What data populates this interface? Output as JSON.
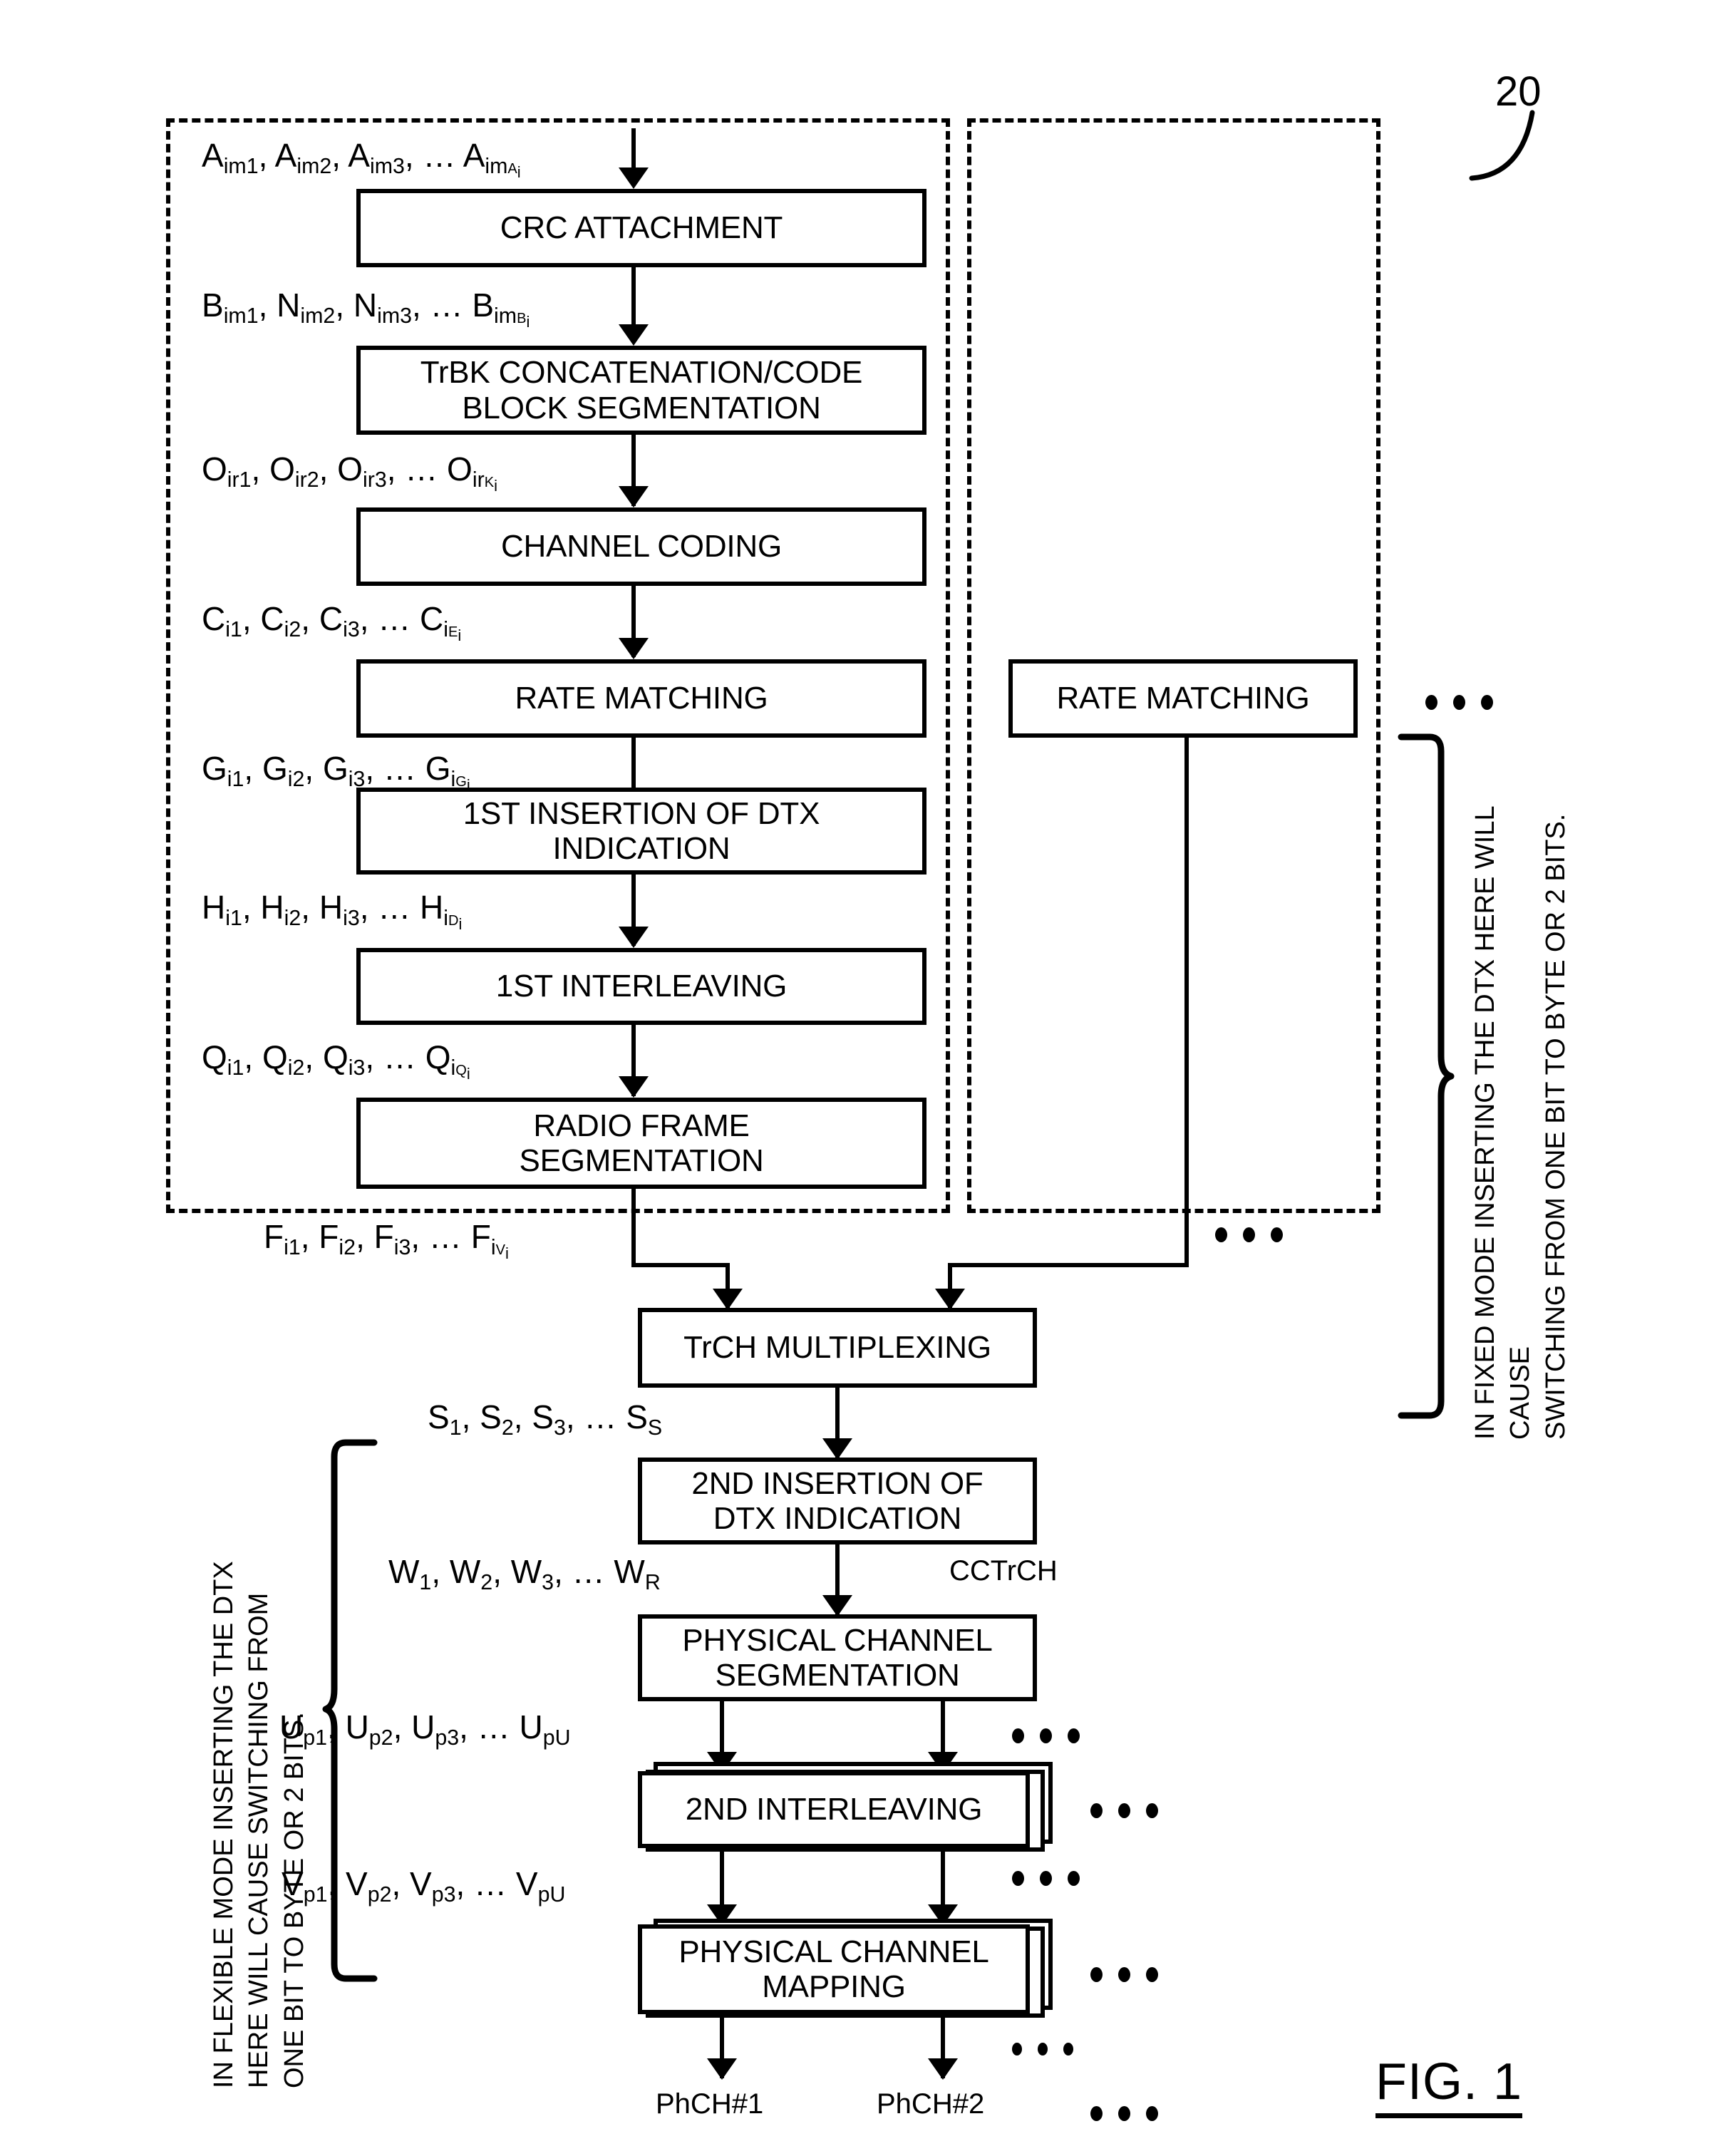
{
  "figure": {
    "reference_numeral": "20",
    "caption": "FIG. 1"
  },
  "blocks": {
    "crc_attachment": "CRC ATTACHMENT",
    "trbk_concat_line1": "TrBK CONCATENATION/CODE",
    "trbk_concat_line2": "BLOCK SEGMENTATION",
    "channel_coding": "CHANNEL CODING",
    "rate_matching": "RATE MATCHING",
    "rate_matching_2": "RATE MATCHING",
    "dtx1_line1": "1ST INSERTION OF DTX",
    "dtx1_line2": "INDICATION",
    "interleaving1": "1ST INTERLEAVING",
    "radio_frame_line1": "RADIO FRAME",
    "radio_frame_line2": "SEGMENTATION",
    "trch_mux": "TrCH MULTIPLEXING",
    "dtx2_line1": "2ND INSERTION OF",
    "dtx2_line2": "DTX INDICATION",
    "phch_seg_line1": "PHYSICAL CHANNEL",
    "phch_seg_line2": "SEGMENTATION",
    "interleaving2": "2ND INTERLEAVING",
    "phch_map_line1": "PHYSICAL CHANNEL",
    "phch_map_line2": "MAPPING"
  },
  "signals": {
    "a": {
      "base": "A",
      "items": [
        "im1",
        "im2",
        "im3"
      ],
      "last_sub": "im",
      "last_sup": "A",
      "last_sup_sub": "i"
    },
    "b": {
      "parts": [
        "B|im1",
        "N|im2",
        "N|im3"
      ],
      "last_base": "B",
      "last_sub": "im",
      "last_sup": "B",
      "last_sup_sub": "i"
    },
    "o": {
      "base": "O",
      "items": [
        "ir1",
        "ir2",
        "ir3"
      ],
      "last_sub": "ir",
      "last_sup": "K",
      "last_sup_sub": "i"
    },
    "c": {
      "base": "C",
      "items": [
        "i1",
        "i2",
        "i3"
      ],
      "last_sub": "i",
      "last_sup": "E",
      "last_sup_sub": "i"
    },
    "g": {
      "base": "G",
      "items": [
        "i1",
        "i2",
        "i3"
      ],
      "last_sub": "i",
      "last_sup": "G",
      "last_sup_sub": "i"
    },
    "h": {
      "base": "H",
      "items": [
        "i1",
        "i2",
        "i3"
      ],
      "last_sub": "i",
      "last_sup": "D",
      "last_sup_sub": "i"
    },
    "q": {
      "base": "Q",
      "items": [
        "i1",
        "i2",
        "i3"
      ],
      "last_sub": "i",
      "last_sup": "Q",
      "last_sup_sub": "i"
    },
    "f": {
      "base": "F",
      "items": [
        "i1",
        "i2",
        "i3"
      ],
      "last_sub": "i",
      "last_sup": "V",
      "last_sup_sub": "i"
    },
    "s": {
      "base": "S",
      "items": [
        "1",
        "2",
        "3"
      ],
      "last_sub": "S"
    },
    "w": {
      "base": "W",
      "items": [
        "1",
        "2",
        "3"
      ],
      "last_sub": "R"
    },
    "u": {
      "base": "U",
      "items": [
        "p1",
        "p2",
        "p3"
      ],
      "last_sub": "pU"
    },
    "v": {
      "base": "V",
      "items": [
        "p1",
        "p2",
        "p3"
      ],
      "last_sub": "pU"
    }
  },
  "labels": {
    "cctrch": "CCTrCH",
    "phch1": "PhCH#1",
    "phch2": "PhCH#2",
    "ellipsis": "…"
  },
  "side_notes": {
    "left": "IN FLEXIBLE MODE INSERTING THE DTX\nHERE WILL CAUSE SWITCHING FROM\nONE BIT TO BYTE OR 2 BITS.",
    "right": "IN FIXED MODE INSERTING THE DTX HERE WILL CAUSE\nSWITCHING FROM ONE BIT TO BYTE OR 2 BITS."
  },
  "colors": {
    "stroke": "#000000",
    "background": "#ffffff"
  }
}
